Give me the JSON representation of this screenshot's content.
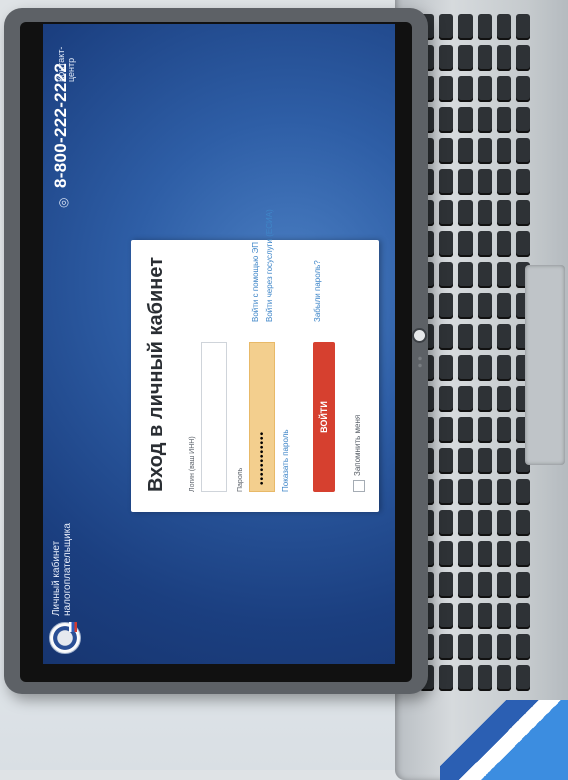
{
  "header": {
    "brand_line1": "Личный кабинет",
    "brand_line2": "налогоплательщика",
    "phone": "8-800-222-2222",
    "contact_center": "Контакт-центр",
    "icon": "eye-icon"
  },
  "login": {
    "title": "Вход в личный кабинет",
    "login_label": "Логин (ваш ИНН)",
    "login_value": "",
    "password_label": "Пароль",
    "password_value": "••••••••••••",
    "show_password": "Показать пароль",
    "submit": "ВОЙТИ",
    "remember_me": "Запомнить меня",
    "ep_link": "Войти с помощью ЭП",
    "esia_link": "Войти через госуслуги (ЕСИА)",
    "forgot_link": "Забыли пароль?"
  },
  "colors": {
    "accent": "#d6402f",
    "link": "#3f86c8",
    "password_field": "#f3cf8e"
  }
}
